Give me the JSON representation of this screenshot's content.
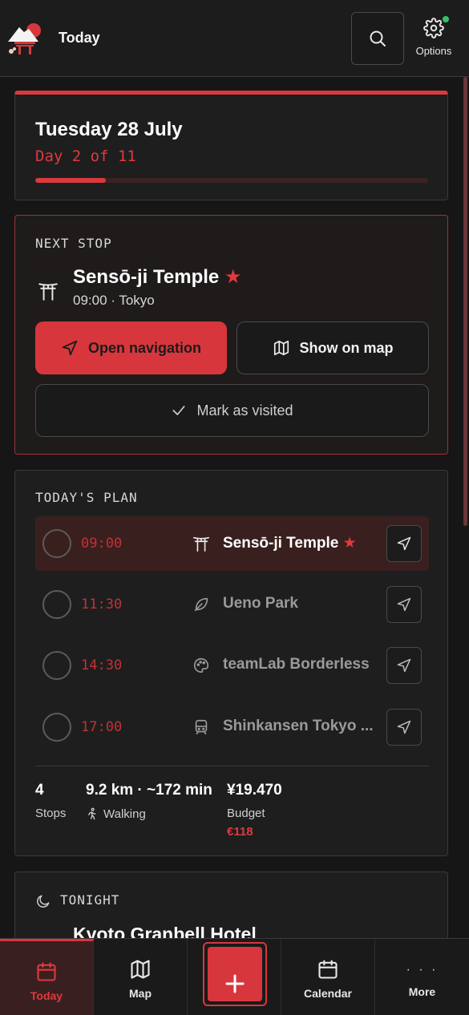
{
  "header": {
    "title": "Today",
    "options_label": "Options"
  },
  "date_card": {
    "title": "Tuesday 28 July",
    "day_count": "Day 2 of 11",
    "progress": 0.18
  },
  "next_stop": {
    "label": "NEXT STOP",
    "name": "Sensō-ji Temple",
    "star": "★",
    "meta": "09:00 · Tokyo",
    "open_navigation": "Open navigation",
    "show_on_map": "Show on map",
    "mark_visited": "Mark as visited"
  },
  "plan": {
    "label": "TODAY'S PLAN",
    "items": [
      {
        "time": "09:00",
        "name": "Sensō-ji Temple",
        "icon": "torii-icon",
        "starred": true
      },
      {
        "time": "11:30",
        "name": "Ueno Park",
        "icon": "leaf-icon",
        "starred": false
      },
      {
        "time": "14:30",
        "name": "teamLab Borderless",
        "icon": "palette-icon",
        "starred": false
      },
      {
        "time": "17:00",
        "name": "Shinkansen Tokyo ...",
        "icon": "train-icon",
        "starred": false
      }
    ],
    "stats": {
      "stops_value": "4",
      "stops_label": "Stops",
      "distance_value": "9.2 km · ~172 min",
      "distance_label": "Walking",
      "budget_value": "¥19.470",
      "budget_label": "Budget",
      "budget_eur": "€118"
    }
  },
  "tonight": {
    "label": "TONIGHT",
    "name": "Kyoto Granbell Hotel"
  },
  "bottom_nav": {
    "today": "Today",
    "map": "Map",
    "calendar": "Calendar",
    "more": "More",
    "more_dots": "· · ·"
  },
  "colors": {
    "accent": "#d7373c",
    "background": "#161616",
    "card": "#1e1e1e"
  }
}
